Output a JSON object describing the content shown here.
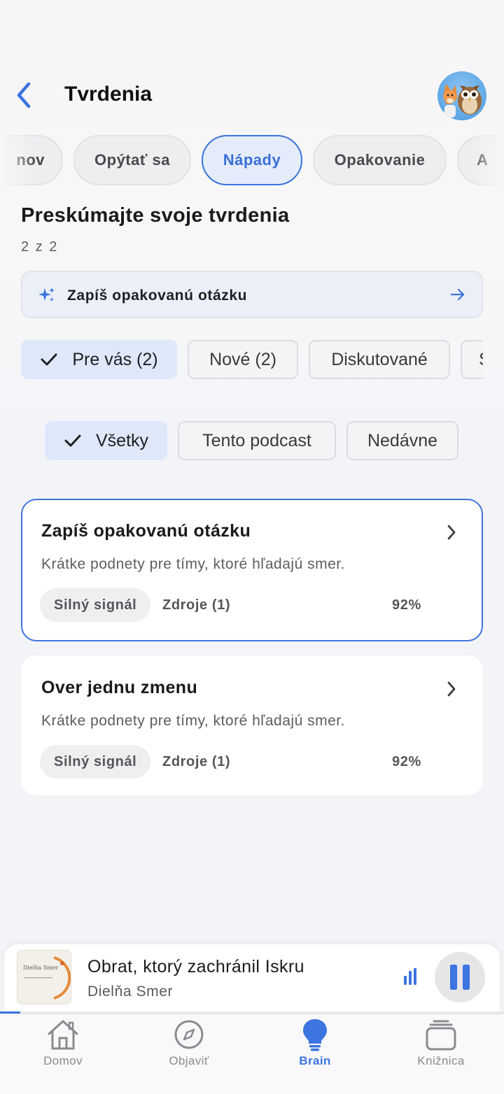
{
  "header": {
    "title": "Tvrdenia"
  },
  "tabs": [
    {
      "label": "Domov",
      "visible_text": "nov"
    },
    {
      "label": "Opýtať sa"
    },
    {
      "label": "Nápady",
      "active": true
    },
    {
      "label": "Opakovanie"
    },
    {
      "label": "A"
    }
  ],
  "section": {
    "title": "Preskúmajte svoje tvrdenia",
    "count": "2 z 2"
  },
  "cta": {
    "label": "Zapíš opakovanú otázku"
  },
  "filters": [
    {
      "label": "Pre vás (2)",
      "active": true
    },
    {
      "label": "Nové (2)"
    },
    {
      "label": "Diskutované"
    },
    {
      "label": "S"
    }
  ],
  "scope": [
    {
      "label": "Všetky",
      "active": true
    },
    {
      "label": "Tento podcast"
    },
    {
      "label": "Nedávne"
    }
  ],
  "cards": [
    {
      "title": "Zapíš opakovanú otázku",
      "description": "Krátke podnety pre tímy, ktoré hľadajú smer.",
      "badge": "Silný signál",
      "sources": "Zdroje (1)",
      "score": "92%",
      "selected": true
    },
    {
      "title": "Over jednu zmenu",
      "description": "Krátke podnety pre tímy, ktoré hľadajú smer.",
      "badge": "Silný signál",
      "sources": "Zdroje (1)",
      "score": "92%",
      "selected": false
    }
  ],
  "player": {
    "title": "Obrat, ktorý zachránil Iskru",
    "artist": "Dielňa Smer",
    "cover_text": "Dielňa Smer",
    "progress": 0.04
  },
  "nav": [
    {
      "label": "Domov",
      "icon": "home-icon"
    },
    {
      "label": "Objaviť",
      "icon": "compass-icon"
    },
    {
      "label": "Brain",
      "icon": "lightbulb-icon",
      "active": true
    },
    {
      "label": "Knižnica",
      "icon": "library-icon"
    }
  ],
  "colors": {
    "accent": "#3c74e0",
    "background": "#f3f4f8"
  }
}
